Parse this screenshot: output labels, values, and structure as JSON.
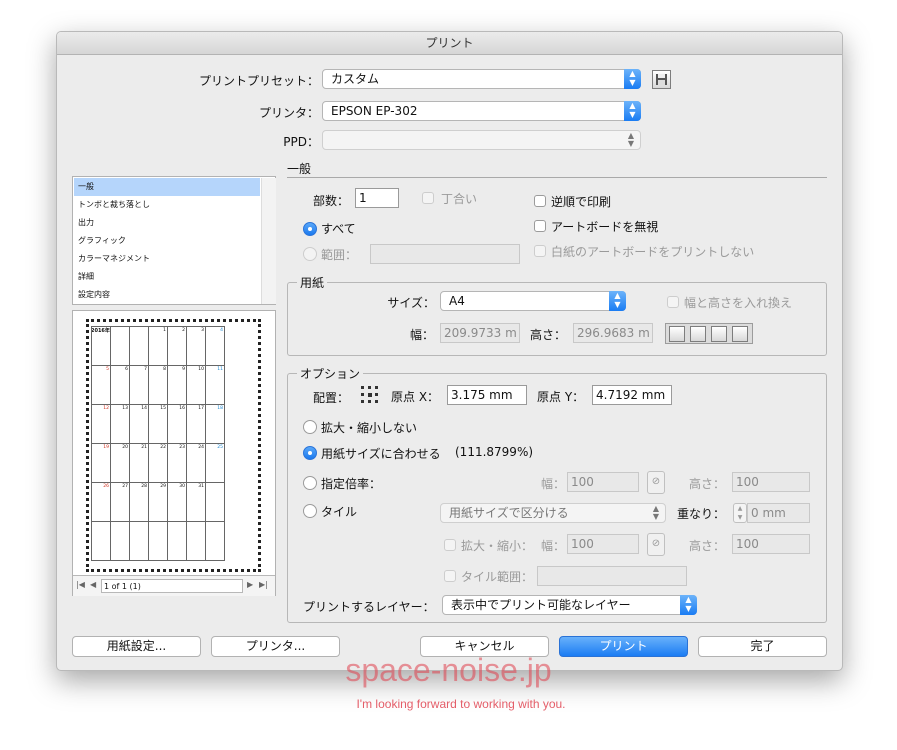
{
  "window": {
    "title": "プリント"
  },
  "header": {
    "preset_label": "プリントプリセット：",
    "preset_value": "カスタム",
    "printer_label": "プリンタ：",
    "printer_value": "EPSON EP-302",
    "ppd_label": "PPD："
  },
  "sidebar": {
    "items": [
      {
        "label": "一般",
        "selected": true
      },
      {
        "label": "トンボと裁ち落とし",
        "selected": false
      },
      {
        "label": "出力",
        "selected": false
      },
      {
        "label": "グラフィック",
        "selected": false
      },
      {
        "label": "カラーマネジメント",
        "selected": false
      },
      {
        "label": "詳細",
        "selected": false
      },
      {
        "label": "設定内容",
        "selected": false
      }
    ]
  },
  "preview": {
    "calendar_header": "2016年",
    "page_indicator": "1 of 1 (1)",
    "calendar_rows": [
      [
        "",
        "",
        "",
        "1",
        "2",
        "3",
        "4"
      ],
      [
        "5",
        "6",
        "7",
        "8",
        "9",
        "10",
        "11"
      ],
      [
        "12",
        "13",
        "14",
        "15",
        "16",
        "17",
        "18"
      ],
      [
        "19",
        "20",
        "21",
        "22",
        "23",
        "24",
        "25"
      ],
      [
        "26",
        "27",
        "28",
        "29",
        "30",
        "31",
        ""
      ],
      [
        "",
        "",
        "",
        "",
        "",
        "",
        ""
      ]
    ]
  },
  "general": {
    "title": "一般",
    "copies_label": "部数：",
    "copies_value": "1",
    "collate_label": "丁合い",
    "reverse_label": "逆順で印刷",
    "ignore_artboards_label": "アートボードを無視",
    "all_label": "すべて",
    "range_label": "範囲：",
    "skip_blank_label": "白紙のアートボードをプリントしない"
  },
  "paper": {
    "title": "用紙",
    "size_label": "サイズ：",
    "size_value": "A4",
    "swap_label": "幅と高さを入れ換え",
    "width_label": "幅：",
    "width_value": "209.9733 m",
    "height_label": "高さ：",
    "height_value": "296.9683 m"
  },
  "options": {
    "title": "オプション",
    "placement_label": "配置：",
    "origin_x_label": "原点 X：",
    "origin_x_value": "3.175 mm",
    "origin_y_label": "原点 Y：",
    "origin_y_value": "4.7192 mm",
    "no_scale_label": "拡大・縮小しない",
    "fit_label": "用紙サイズに合わせる",
    "fit_percent": "(111.8799%)",
    "custom_scale_label": "指定倍率：",
    "scale_w_label": "幅：",
    "scale_w_value": "100",
    "scale_h_label": "高さ：",
    "scale_h_value": "100",
    "tile_label": "タイル",
    "tile_mode_value": "用紙サイズで区分ける",
    "overlap_label": "重なり：",
    "overlap_value": "0 mm",
    "tile_scale_label": "拡大・縮小：",
    "tile_w_label": "幅：",
    "tile_w_value": "100",
    "tile_h_label": "高さ：",
    "tile_h_value": "100",
    "tile_range_label": "タイル範囲：",
    "layers_label": "プリントするレイヤー：",
    "layers_value": "表示中でプリント可能なレイヤー"
  },
  "buttons": {
    "page_setup": "用紙設定...",
    "printer": "プリンタ...",
    "cancel": "キャンセル",
    "print": "プリント",
    "done": "完了"
  },
  "watermark": {
    "site": "space-noise.jp",
    "tagline": "I'm looking forward to working with you."
  },
  "colors": {
    "accent": "#1b7cf3",
    "watermark": "#e0424f",
    "sunday": "#d0301f",
    "saturday": "#1e88d0"
  }
}
